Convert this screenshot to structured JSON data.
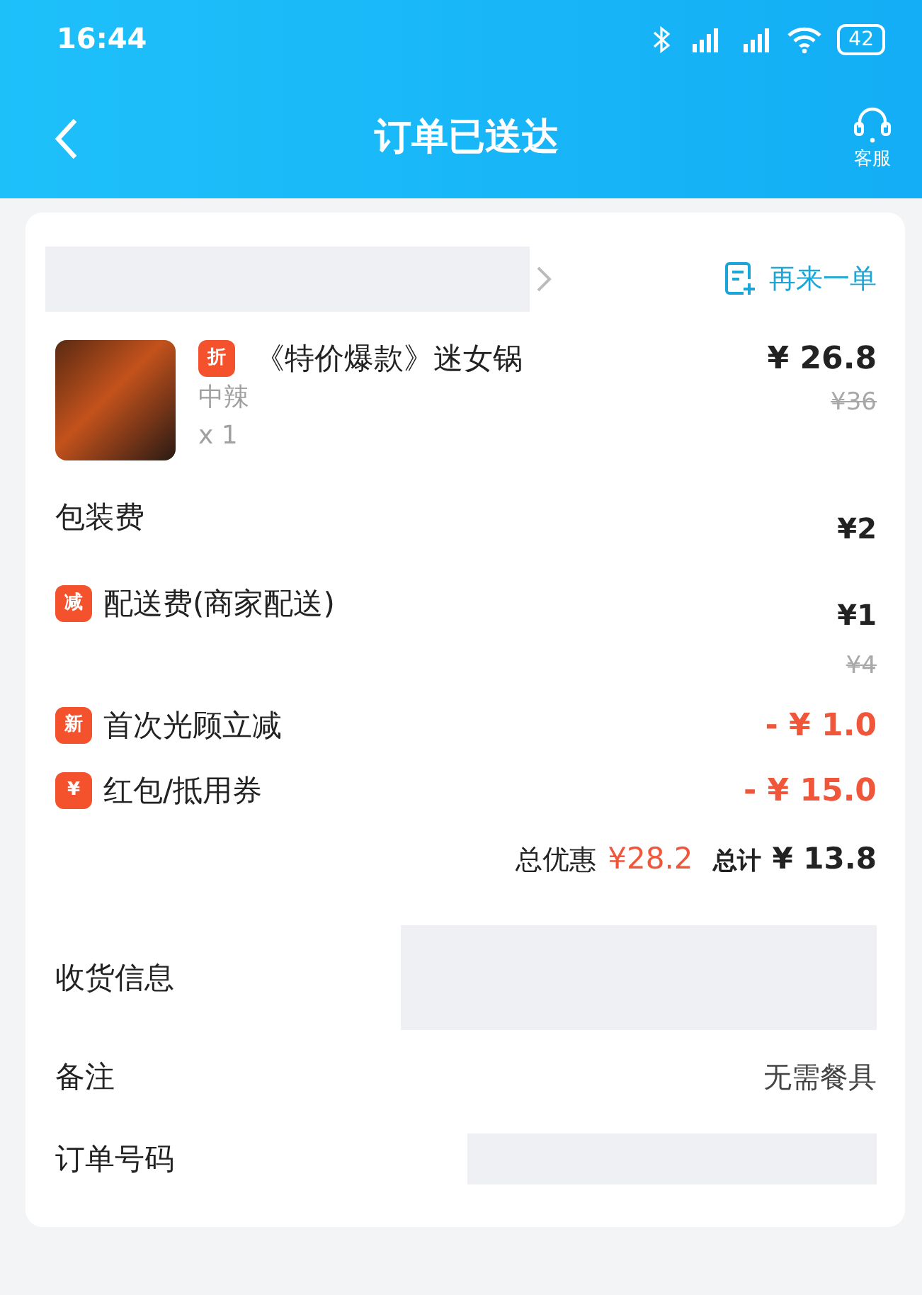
{
  "status_bar": {
    "time": "16:44",
    "battery": "42"
  },
  "header": {
    "title": "订单已送达",
    "service_label": "客服"
  },
  "order": {
    "reorder_label": "再来一单",
    "item": {
      "badge": "折",
      "name": "《特价爆款》迷女锅",
      "spec": "中辣",
      "qty": "x 1",
      "price": "¥ 26.8",
      "original_price": "¥36"
    },
    "fees": [
      {
        "kind": "fee",
        "label": "包装费",
        "amount": "¥2"
      },
      {
        "kind": "fee",
        "badge": "减",
        "label": "配送费(商家配送)",
        "amount": "¥1",
        "original_amount": "¥4"
      },
      {
        "kind": "discount",
        "badge": "新",
        "label": "首次光顾立减",
        "amount": "- ¥ 1.0"
      },
      {
        "kind": "discount",
        "badge": "¥",
        "label": "红包/抵用券",
        "amount": "- ¥ 15.0"
      }
    ],
    "summary": {
      "discount_label": "总优惠",
      "discount_amount": "¥28.2",
      "total_label": "总计",
      "total_amount": "¥ 13.8"
    }
  },
  "info": [
    {
      "kind": "redacted",
      "label": "收货信息"
    },
    {
      "kind": "text",
      "label": "备注",
      "value": "无需餐具"
    },
    {
      "kind": "redacted_short",
      "label": "订单号码"
    }
  ]
}
